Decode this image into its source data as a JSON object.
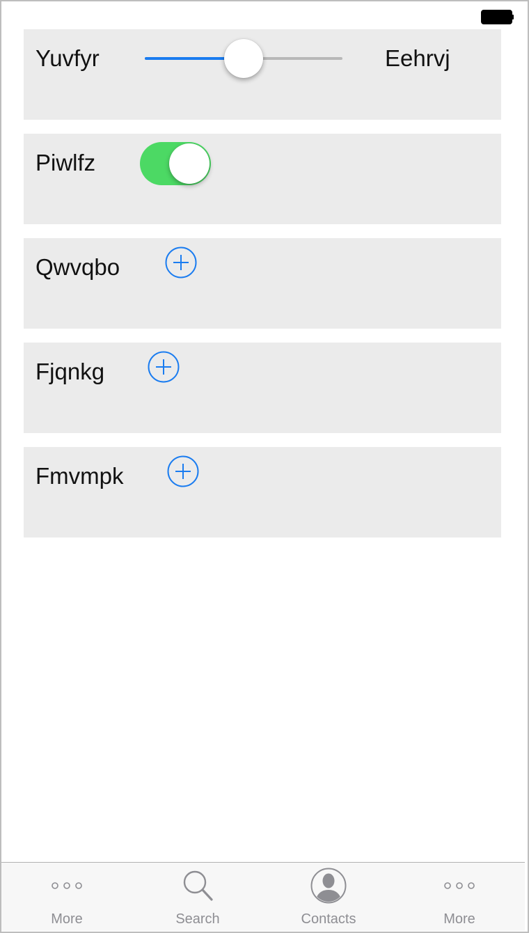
{
  "status_bar": {
    "battery_icon": "battery-full-icon"
  },
  "rows": [
    {
      "type": "slider",
      "label": "Yuvfyr",
      "right_label": "Eehrvj",
      "value": 0.5,
      "accent_color": "#1a7cf0"
    },
    {
      "type": "toggle",
      "label": "Piwlfz",
      "on": true,
      "on_color": "#4cd964"
    },
    {
      "type": "add",
      "label": "Qwvqbo",
      "icon": "add-circle-icon"
    },
    {
      "type": "add",
      "label": "Fjqnkg",
      "icon": "add-circle-icon"
    },
    {
      "type": "add",
      "label": "Fmvmpk",
      "icon": "add-circle-icon"
    }
  ],
  "tab_bar": {
    "items": [
      {
        "label": "More",
        "icon": "more-dots-icon"
      },
      {
        "label": "Search",
        "icon": "search-icon"
      },
      {
        "label": "Contacts",
        "icon": "contacts-person-icon"
      },
      {
        "label": "More",
        "icon": "more-dots-icon"
      }
    ],
    "inactive_color": "#8e8e93"
  }
}
